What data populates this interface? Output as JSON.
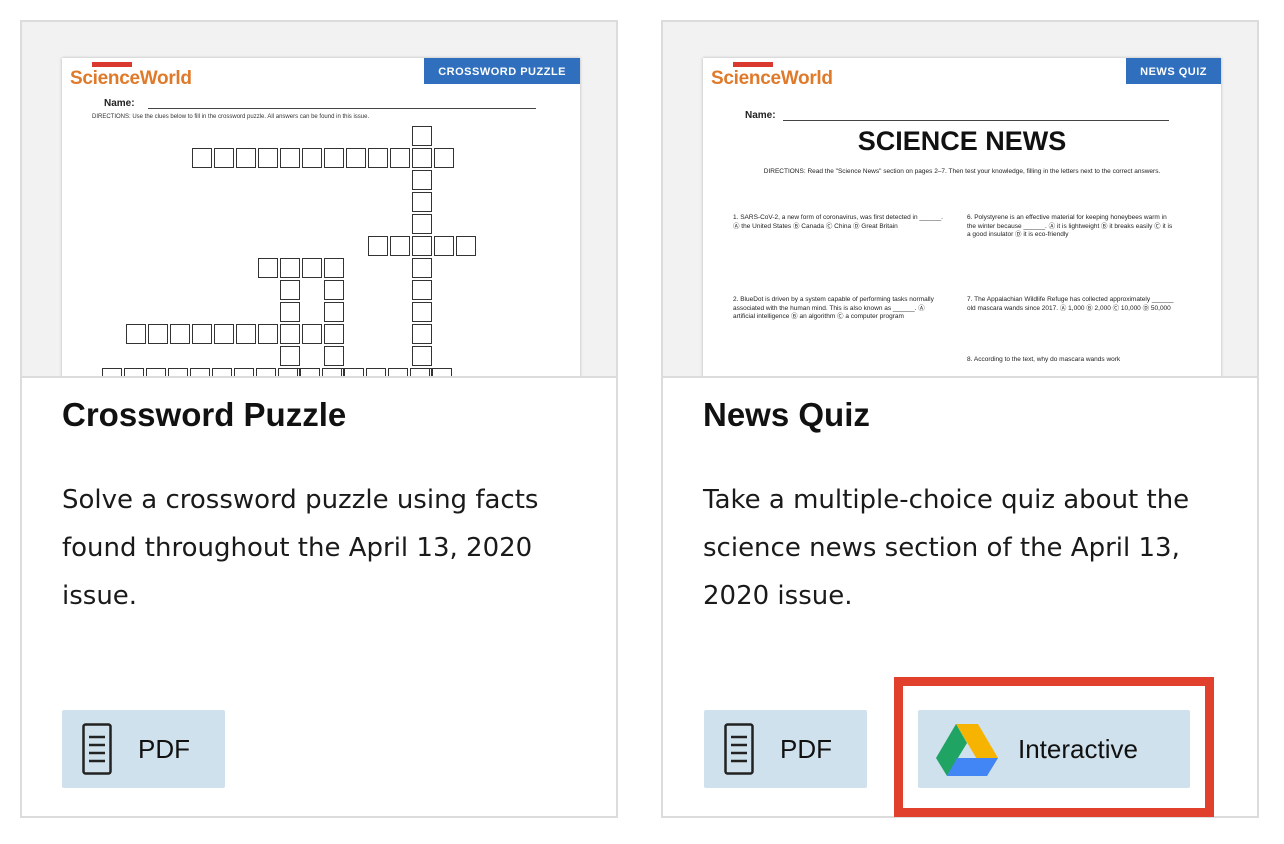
{
  "cards": [
    {
      "title": "Crossword Puzzle",
      "description": "Solve a crossword puzzle using facts found throughout the April 13, 2020 issue.",
      "thumbnail": {
        "logo": "ScienceWorld",
        "ribbon": "CROSSWORD PUZZLE",
        "name_label": "Name:",
        "directions": "DIRECTIONS: Use the clues below to fill in the crossword puzzle. All answers can be found in this issue."
      },
      "buttons": [
        {
          "label": "PDF",
          "icon": "document-icon"
        }
      ]
    },
    {
      "title": "News Quiz",
      "description": "Take a multiple-choice quiz about the science news section of the April 13, 2020 issue.",
      "thumbnail": {
        "logo": "ScienceWorld",
        "ribbon": "NEWS QUIZ",
        "name_label": "Name:",
        "heading": "SCIENCE NEWS",
        "directions": "DIRECTIONS: Read the \"Science News\" section on pages 2–7. Then test your knowledge, filling in the letters next to the correct answers.",
        "questions": [
          "1. SARS-CoV-2, a new form of coronavirus, was first detected in ______. Ⓐ the United States Ⓑ Canada Ⓒ China Ⓓ Great Britain",
          "6. Polystyrene is an effective material for keeping honeybees warm in the winter because ______. Ⓐ it is lightweight Ⓑ it breaks easily Ⓒ it is a good insulator Ⓓ it is eco-friendly",
          "2. BlueDot is driven by a system capable of performing tasks normally associated with the human mind. This is also known as ______. Ⓐ artificial intelligence Ⓑ an algorithm Ⓒ a computer program",
          "7. The Appalachian Wildlife Refuge has collected approximately ______ old mascara wands since 2017. Ⓐ 1,000 Ⓑ 2,000 Ⓒ 10,000 Ⓓ 50,000",
          "8. According to the text, why do mascara wands work"
        ]
      },
      "buttons": [
        {
          "label": "PDF",
          "icon": "document-icon"
        },
        {
          "label": "Interactive",
          "icon": "google-drive-icon"
        }
      ]
    }
  ],
  "colors": {
    "button_bg": "#cfe1ec",
    "highlight": "#e0402c",
    "ribbon": "#2f6fbd",
    "logo": "#e07a2b"
  }
}
